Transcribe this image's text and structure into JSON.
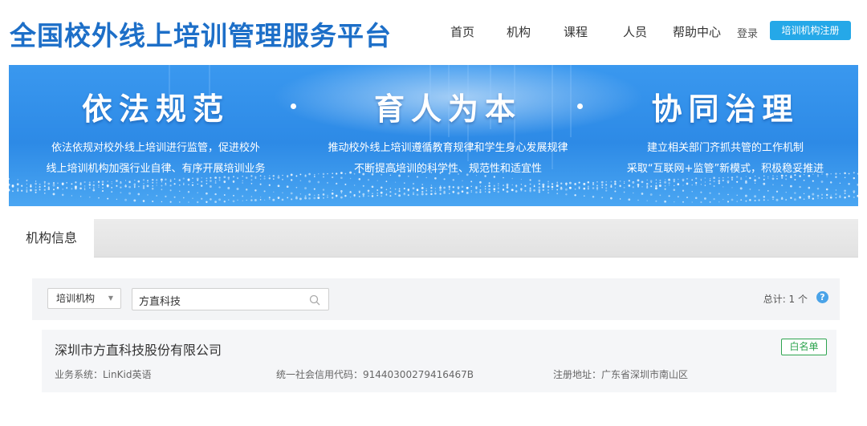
{
  "header": {
    "logo_text": "全国校外线上培训管理服务平台",
    "nav": [
      "首页",
      "机构",
      "课程",
      "人员",
      "帮助中心"
    ],
    "login": "登录",
    "register": "培训机构注册"
  },
  "banner": {
    "pillars": [
      {
        "title": "依法规范",
        "lines": [
          "依法依规对校外线上培训进行监管，促进校外",
          "线上培训机构加强行业自律、有序开展培训业务"
        ]
      },
      {
        "title": "育人为本",
        "lines": [
          "推动校外线上培训遵循教育规律和学生身心发展规律",
          "不断提高培训的科学性、规范性和适宜性"
        ]
      },
      {
        "title": "协同治理",
        "lines": [
          "建立相关部门齐抓共管的工作机制",
          "采取“互联网+监管”新模式，积极稳妥推进"
        ]
      }
    ]
  },
  "panel": {
    "tab": "机构信息",
    "filter_select": "培训机构",
    "search_value": "方直科技",
    "total": "总计: 1 个",
    "help": "?"
  },
  "result": {
    "name": "深圳市方直科技股份有限公司",
    "badge": "白名单",
    "business": "业务系统：LinKid英语",
    "credit_code": "统一社会信用代码：91440300279416467B",
    "address": "注册地址：广东省深圳市南山区"
  },
  "colors": {
    "logo": "#1d6fc8",
    "register_button": "#25a8e8",
    "banner": "#2d8ae6",
    "badge": "#2ea44f"
  }
}
